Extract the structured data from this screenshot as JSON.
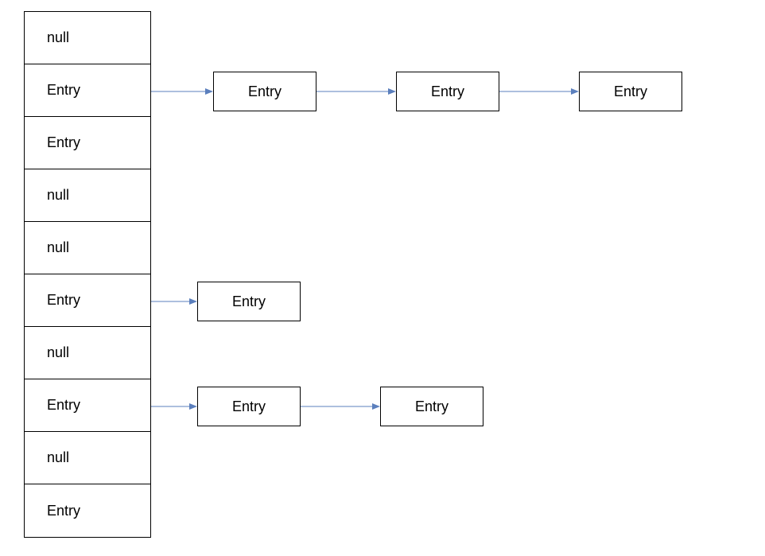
{
  "buckets": [
    {
      "label": "null"
    },
    {
      "label": "Entry"
    },
    {
      "label": "Entry"
    },
    {
      "label": "null"
    },
    {
      "label": "null"
    },
    {
      "label": "Entry"
    },
    {
      "label": "null"
    },
    {
      "label": "Entry"
    },
    {
      "label": "null"
    },
    {
      "label": "Entry"
    }
  ],
  "chains": {
    "row1": [
      {
        "label": "Entry"
      },
      {
        "label": "Entry"
      },
      {
        "label": "Entry"
      }
    ],
    "row5": [
      {
        "label": "Entry"
      }
    ],
    "row7": [
      {
        "label": "Entry"
      },
      {
        "label": "Entry"
      }
    ]
  }
}
